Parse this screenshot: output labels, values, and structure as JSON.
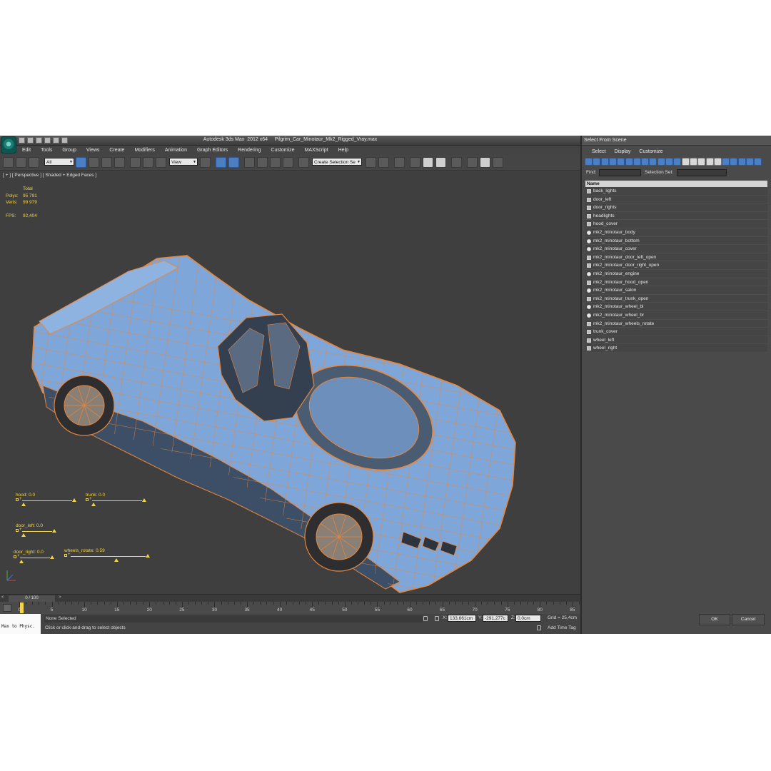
{
  "window": {
    "title": "Autodesk 3ds Max  2012 x64     Pilgrim_Car_Minotaur_Mk2_Rigged_Vray.max"
  },
  "menu": [
    "Edit",
    "Tools",
    "Group",
    "Views",
    "Create",
    "Modifiers",
    "Animation",
    "Graph Editors",
    "Rendering",
    "Customize",
    "MAXScript",
    "Help"
  ],
  "toolbar": {
    "selection_filter": "All",
    "reference_coord": "View",
    "named_selection_set": "Create Selection Se"
  },
  "viewport": {
    "label": "[ + ] [ Perspective ] [ Shaded + Edged Faces ]",
    "stats": {
      "total_label": "Total",
      "polys_label": "Polys:",
      "polys_value": "95 791",
      "verts_label": "Verts:",
      "verts_value": "99 979",
      "fps_label": "FPS:",
      "fps_value": "92,404"
    },
    "controls": [
      {
        "label": "hood: 0.0",
        "value": 0.0
      },
      {
        "label": "trunk: 0.0",
        "value": 0.0
      },
      {
        "label": "door_left: 0.0",
        "value": 0.0
      },
      {
        "label": "door_right: 0.0",
        "value": 0.0
      },
      {
        "label": "wheels_rotate: 0.59",
        "value": 0.59
      }
    ],
    "colors": {
      "background": "#3f3f3f",
      "car_fill": "#7ea6d8",
      "wire": "#e8863a",
      "annotation": "#f2d34a"
    }
  },
  "timeline": {
    "readout": "0 / 100",
    "prev": "<",
    "next": ">",
    "ticks": [
      0,
      5,
      10,
      15,
      20,
      25,
      30,
      35,
      40,
      45,
      50,
      55,
      60,
      65,
      70,
      75,
      80,
      85
    ]
  },
  "status": {
    "maxscript": "Max to Physc.",
    "selection": "None Selected",
    "prompt": "Click or click-and-drag to select objects",
    "x_label": "X:",
    "x_value": "133,661cm",
    "y_label": "Y:",
    "y_value": "-291,277c",
    "z_label": "Z:",
    "z_value": "0,0cm",
    "grid": "Grid = 25,4cm",
    "add_time_tag": "Add Time Tag"
  },
  "select_from_scene": {
    "title": "Select From Scene",
    "menu": [
      "Select",
      "Display",
      "Customize"
    ],
    "find_label": "Find:",
    "selection_set_label": "Selection Set:",
    "column_header": "Name",
    "items": [
      {
        "name": "back_lights",
        "icon": "helper-icon"
      },
      {
        "name": "door_left",
        "icon": "helper-icon"
      },
      {
        "name": "door_rights",
        "icon": "helper-icon"
      },
      {
        "name": "headlights",
        "icon": "helper-icon"
      },
      {
        "name": "hood_cover",
        "icon": "helper-icon"
      },
      {
        "name": "mk2_minotaur_body",
        "icon": "geometry-icon"
      },
      {
        "name": "mk2_minotaur_bottom",
        "icon": "geometry-icon"
      },
      {
        "name": "mk2_minotaur_cover",
        "icon": "geometry-icon"
      },
      {
        "name": "mk2_minotaur_door_left_open",
        "icon": "helper-icon"
      },
      {
        "name": "mk2_minotaur_door_right_open",
        "icon": "helper-icon"
      },
      {
        "name": "mk2_minotaur_engine",
        "icon": "geometry-icon"
      },
      {
        "name": "mk2_minotaur_hood_open",
        "icon": "helper-icon"
      },
      {
        "name": "mk2_minotaur_salon",
        "icon": "geometry-icon"
      },
      {
        "name": "mk2_minotaur_trunk_open",
        "icon": "helper-icon"
      },
      {
        "name": "mk2_minotaur_wheel_bl",
        "icon": "geometry-icon"
      },
      {
        "name": "mk2_minotaur_wheel_br",
        "icon": "geometry-icon"
      },
      {
        "name": "mk2_minotaur_wheels_rotate",
        "icon": "helper-icon"
      },
      {
        "name": "trunk_cover",
        "icon": "helper-icon"
      },
      {
        "name": "wheel_left",
        "icon": "helper-icon"
      },
      {
        "name": "wheel_right",
        "icon": "helper-icon"
      }
    ],
    "ok_label": "OK",
    "cancel_label": "Cancel"
  }
}
